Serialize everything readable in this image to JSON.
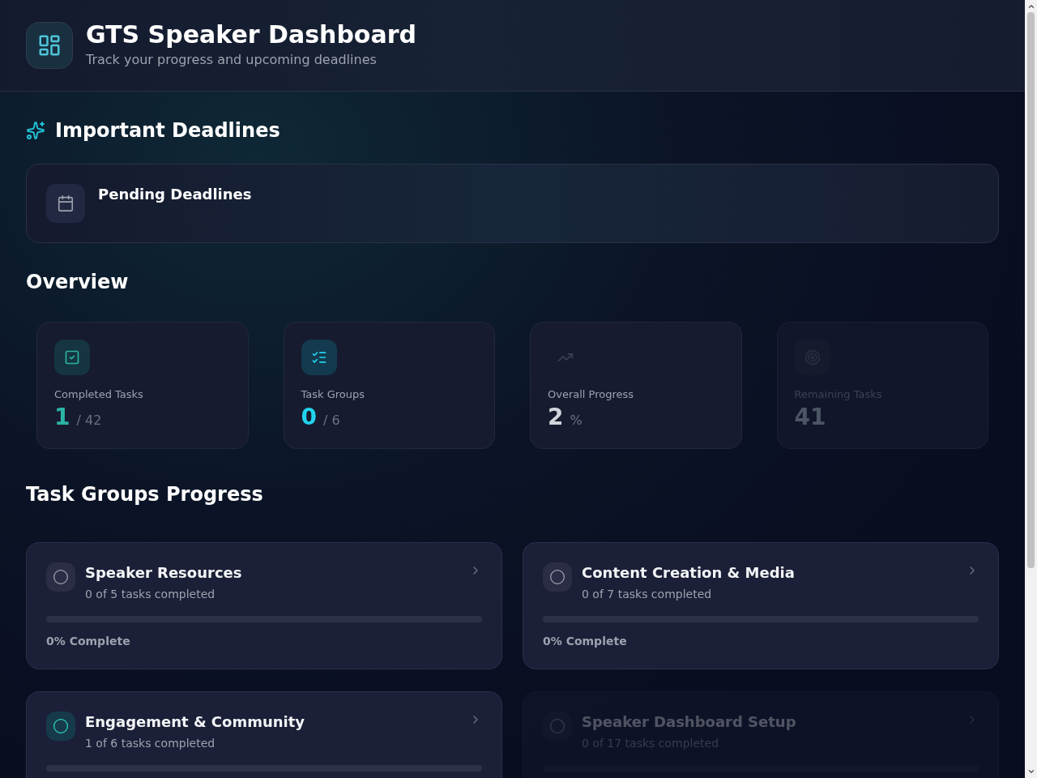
{
  "header": {
    "title": "GTS Speaker Dashboard",
    "subtitle": "Track your progress and upcoming deadlines"
  },
  "deadlines": {
    "heading": "Important Deadlines",
    "card_title": "Pending Deadlines"
  },
  "overview": {
    "heading": "Overview",
    "stats": [
      {
        "kind": "completed",
        "label": "Completed Tasks",
        "value": "1",
        "suffix": "/ 42",
        "color": "#2bb3a3",
        "faded": false
      },
      {
        "kind": "groups",
        "label": "Task Groups",
        "value": "0",
        "suffix": "/ 6",
        "color": "#22d3ee",
        "faded": false
      },
      {
        "kind": "progress",
        "label": "Overall Progress",
        "value": "2",
        "suffix": "%",
        "color": "#d1d5db",
        "faded": false
      },
      {
        "kind": "remaining",
        "label": "Remaining Tasks",
        "value": "41",
        "color": "#4b5563",
        "faded": true
      }
    ]
  },
  "task_groups": {
    "heading": "Task Groups Progress",
    "groups": [
      {
        "kind": "pending",
        "title": "Speaker Resources",
        "subtitle": "0 of 5 tasks completed",
        "progress_label": "0% Complete",
        "faded": false
      },
      {
        "kind": "pending",
        "title": "Content Creation & Media",
        "subtitle": "0 of 7 tasks completed",
        "progress_label": "0% Complete",
        "faded": false
      },
      {
        "kind": "active",
        "title": "Engagement & Community",
        "subtitle": "1 of 6 tasks completed",
        "faded": false
      },
      {
        "kind": "pending",
        "title": "Speaker Dashboard Setup",
        "subtitle": "0 of 17 tasks completed",
        "faded": true
      }
    ]
  }
}
